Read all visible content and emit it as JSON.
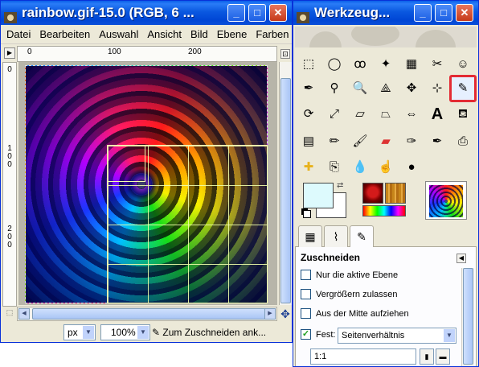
{
  "image_window": {
    "title": "rainbow.gif-15.0 (RGB, 6 ...",
    "menu": [
      "Datei",
      "Bearbeiten",
      "Auswahl",
      "Ansicht",
      "Bild",
      "Ebene",
      "Farben"
    ],
    "hruler_labels": [
      "0",
      "100",
      "200"
    ],
    "vruler_labels": [
      "0",
      "100",
      "200"
    ],
    "status": {
      "unit": "px",
      "zoom": "100%",
      "message": "Zum Zuschneiden ank..."
    }
  },
  "toolbox": {
    "title": "Werkzeug...",
    "tools": [
      "rect-select-icon",
      "ellipse-select-icon",
      "lasso-icon",
      "fuzzy-select-icon",
      "color-select-icon",
      "scissors-icon",
      "foreground-select-icon",
      "paths-icon",
      "color-picker-icon",
      "zoom-icon",
      "measure-icon",
      "move-icon",
      "align-icon",
      "crop-icon",
      "rotate-icon",
      "scale-icon",
      "shear-icon",
      "perspective-icon",
      "flip-icon",
      "text-icon",
      "bucket-fill-icon",
      "blend-icon",
      "pencil-icon",
      "paintbrush-icon",
      "eraser-icon",
      "airbrush-icon",
      "ink-icon",
      "clone-icon",
      "heal-icon",
      "perspective-clone-icon",
      "blur-icon",
      "smudge-icon",
      "dodge-burn-icon"
    ],
    "active_tool_index": 13,
    "colors": {
      "fg": "#ddfafd",
      "bg": "#ffffff",
      "active_border": "#e32b34"
    },
    "tool_options": {
      "title": "Zuschneiden",
      "current_layer_only": {
        "label": "Nur die aktive Ebene",
        "checked": false
      },
      "allow_growing": {
        "label": "Vergrößern zulassen",
        "checked": false
      },
      "expand_from_center": {
        "label": "Aus der Mitte aufziehen",
        "checked": false
      },
      "fixed": {
        "label": "Fest:",
        "checked": true,
        "value": "Seitenverhältnis"
      },
      "ratio": "1:1"
    }
  }
}
